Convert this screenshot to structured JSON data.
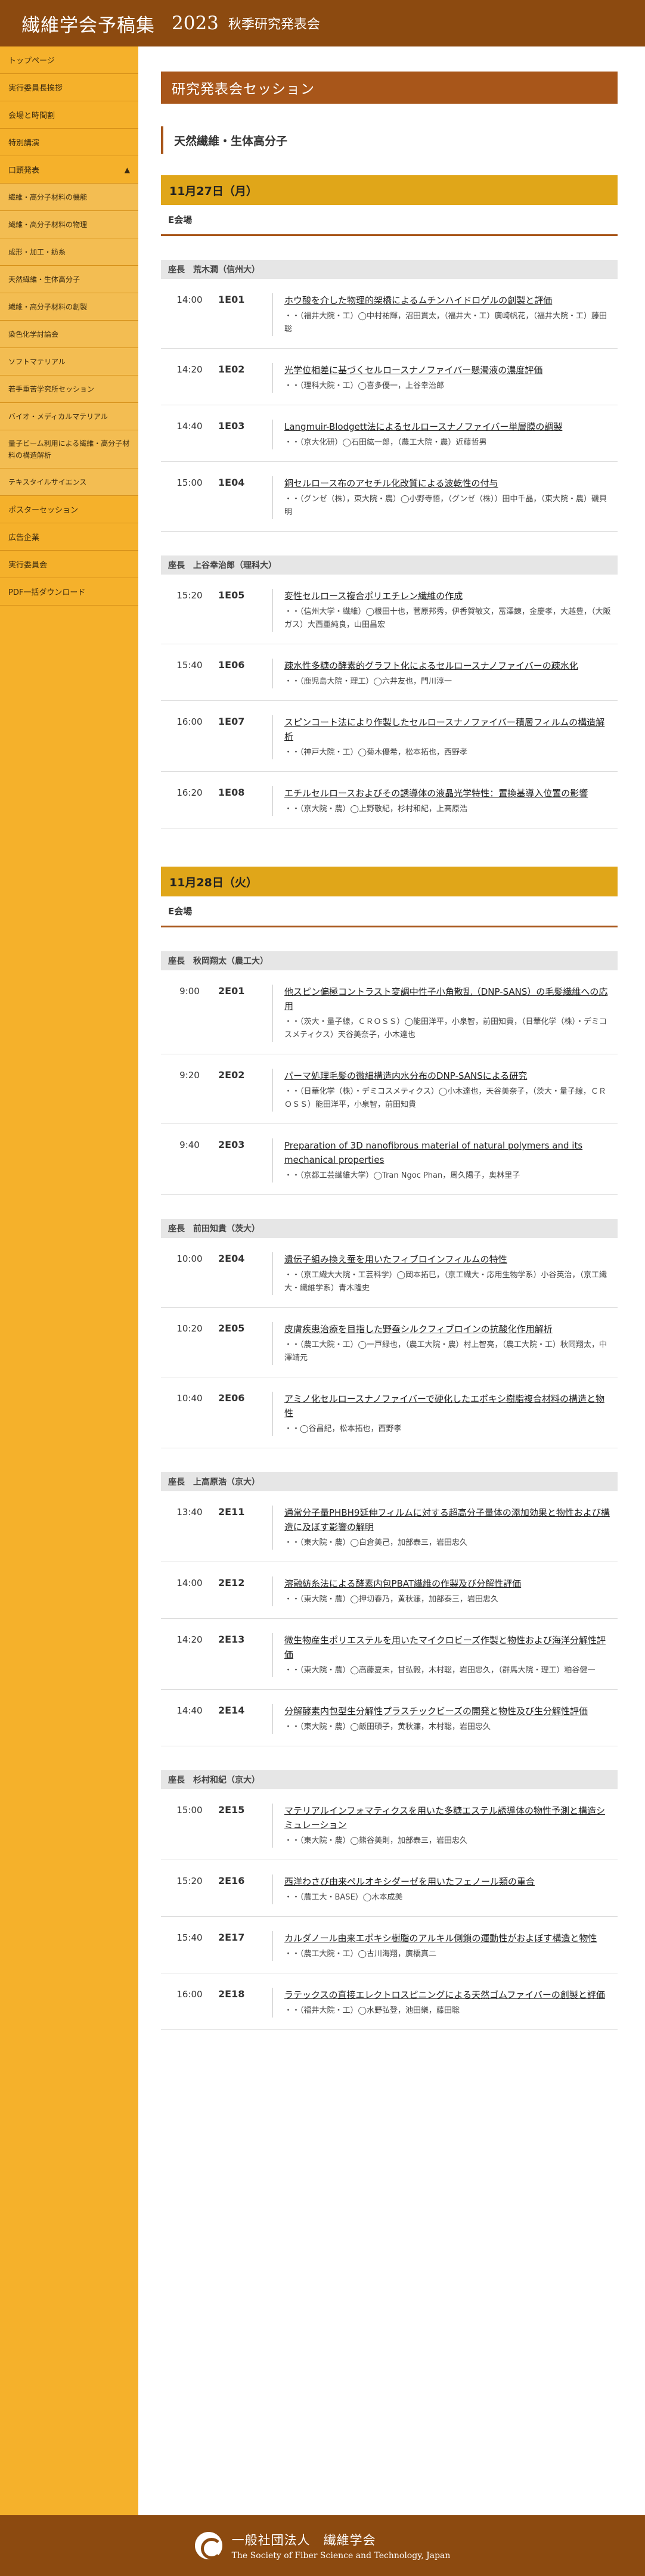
{
  "header": {
    "brand": "繊維学会予稿集",
    "year": "2023",
    "subtitle": "秋季研究発表会"
  },
  "sidebar": {
    "items": [
      {
        "label": "トップページ"
      },
      {
        "label": "実行委員長挨拶"
      },
      {
        "label": "会場と時間割"
      },
      {
        "label": "特別講演"
      },
      {
        "label": "口頭発表",
        "expanded": true
      },
      {
        "label": "繊維・高分子材料の機能",
        "sub": true
      },
      {
        "label": "繊維・高分子材料の物理",
        "sub": true
      },
      {
        "label": "成形・加工・紡糸",
        "sub": true
      },
      {
        "label": "天然繊維・生体高分子",
        "sub": true
      },
      {
        "label": "繊維・高分子材料の創製",
        "sub": true
      },
      {
        "label": "染色化学討論会",
        "sub": true
      },
      {
        "label": "ソフトマテリアル",
        "sub": true
      },
      {
        "label": "若手重苦学究所セッション",
        "sub": true
      },
      {
        "label": "バイオ・メディカルマテリアル",
        "sub": true
      },
      {
        "label": "量子ビーム利用による繊維・高分子材料の構造解析",
        "sub": true,
        "tall": true
      },
      {
        "label": "テキスタイルサイエンス",
        "sub": true
      },
      {
        "label": "ポスターセッション"
      },
      {
        "label": "広告企業"
      },
      {
        "label": "実行委員会"
      },
      {
        "label": "PDF一括ダウンロード"
      }
    ]
  },
  "page_title": "研究発表会セッション",
  "session_title": "天然繊維・生体高分子",
  "days": [
    {
      "date": "11月27日（月）",
      "room": "E会場",
      "blocks": [
        {
          "chair": "座長　荒木潤（信州大）",
          "talks": [
            {
              "time": "14:00",
              "code": "1E01",
              "title": "ホウ酸を介した物理的架橋によるムチンハイドロゲルの創製と評価",
              "authors": "・・（福井大院・工）◯中村祐輝，沼田貫太，（福井大・工）廣崎帆花，（福井大院・工）藤田聡"
            },
            {
              "time": "14:20",
              "code": "1E02",
              "title": "光学位相差に基づくセルロースナノファイバー懸濁液の濃度評価",
              "authors": "・・（理科大院・工）◯喜多優一，上谷幸治郎"
            },
            {
              "time": "14:40",
              "code": "1E03",
              "title": "Langmuir-Blodgett法によるセルロースナノファイバー単層膜の調製",
              "authors": "・・（京大化研）◯石田紘一郎，（農工大院・農）近藤哲男"
            },
            {
              "time": "15:00",
              "code": "1E04",
              "title": "銅セルロース布のアセチル化改質による波乾性の付与",
              "authors": "・・（グンゼ（株），東大院・農）◯小野寺悟，（グンゼ（株））田中千晶，（東大院・農）磯貝明"
            }
          ]
        },
        {
          "chair": "座長　上谷幸治郎（理科大）",
          "talks": [
            {
              "time": "15:20",
              "code": "1E05",
              "title": "変性セルロース複合ポリエチレン繊維の作成",
              "authors": "・・（信州大学・繊維）◯根田十也，菅原邦秀，伊香賀敏文，冨澤錬，金慶孝，大越豊，（大阪ガス）大西亜純良，山田昌宏"
            },
            {
              "time": "15:40",
              "code": "1E06",
              "title": "疎水性多糖の酵素的グラフト化によるセルロースナノファイバーの疎水化",
              "authors": "・・（鹿児島大院・理工）◯六井友也，門川淳一"
            },
            {
              "time": "16:00",
              "code": "1E07",
              "title": "スピンコート法により作製したセルロースナノファイバー積層フィルムの構造解析",
              "authors": "・・（神戸大院・工）◯菊木優希，松本拓也，西野孝"
            },
            {
              "time": "16:20",
              "code": "1E08",
              "title": "エチルセルロースおよびその誘導体の液晶光学特性：置換基導入位置の影響",
              "authors": "・・（京大院・農）◯上野敬紀，杉村和紀，上高原浩"
            }
          ]
        }
      ]
    },
    {
      "date": "11月28日（火）",
      "room": "E会場",
      "blocks": [
        {
          "chair": "座長　秋岡翔太（農工大）",
          "talks": [
            {
              "time": "9:00",
              "code": "2E01",
              "title": "他スピン偏極コントラスト変調中性子小角散乱（DNP-SANS）の毛髪繊維への応用",
              "authors": "・・（茨大・量子線，ＣＲＯＳＳ）◯能田洋平，小泉智，前田知貴，（日華化学（株）・デミコスメティクス）天谷美奈子，小木達也"
            },
            {
              "time": "9:20",
              "code": "2E02",
              "title": "パーマ処理毛髪の微細構造内水分布のDNP-SANSによる研究",
              "authors": "・・（日華化学（株）・デミコスメティクス）◯小木達也，天谷美奈子，（茨大・量子線，ＣＲＯＳＳ）能田洋平，小泉智，前田知貴"
            },
            {
              "time": "9:40",
              "code": "2E03",
              "title": "Preparation of 3D nanofibrous material of natural polymers and its mechanical properties",
              "authors": "・・（京都工芸繊維大学）◯Tran Ngoc Phan，周久陽子，奥林里子"
            }
          ]
        },
        {
          "chair": "座長　前田知貴（茨大）",
          "talks": [
            {
              "time": "10:00",
              "code": "2E04",
              "title": "遺伝子組み換え蚕を用いたフィブロインフィルムの特性",
              "authors": "・・（京工繊大大院・工芸科学）◯岡本拓巳，（京工繊大・応用生物学系）小谷英治，（京工繊大・繊維学系）青木隆史"
            },
            {
              "time": "10:20",
              "code": "2E05",
              "title": "皮膚疾患治療を目指した野蚕シルクフィブロインの抗酸化作用解析",
              "authors": "・・（農工大院・工）◯一戸緑也，（農工大院・農）村上智亮，（農工大院・工）秋岡翔太，中澤靖元"
            },
            {
              "time": "10:40",
              "code": "2E06",
              "title": "アミノ化セルロースナノファイバーで硬化したエポキシ樹脂複合材料の構造と物性",
              "authors": "・・◯谷昌紀，松本拓也，西野孝"
            }
          ]
        },
        {
          "chair": "座長　上高原浩（京大）",
          "talks": [
            {
              "time": "13:40",
              "code": "2E11",
              "title": "通常分子量PHBH9延伸フィルムに対する超高分子量体の添加効果と物性および構造に及ぼす影響の解明",
              "authors": "・・（東大院・農）◯白倉美己，加部泰三，岩田忠久"
            },
            {
              "time": "14:00",
              "code": "2E12",
              "title": "溶融紡糸法による酵素内包PBAT繊維の作製及び分解性評価",
              "authors": "・・（東大院・農）◯押切春乃，黄秋濂，加部泰三，岩田忠久"
            },
            {
              "time": "14:20",
              "code": "2E13",
              "title": "微生物産生ポリエステルを用いたマイクロビーズ作製と物性および海洋分解性評価",
              "authors": "・・（東大院・農）◯高藤夏未，甘弘毅，木村聡，岩田忠久，（群馬大院・理工）粕谷健一"
            },
            {
              "time": "14:40",
              "code": "2E14",
              "title": "分解酵素内包型生分解性プラスチックビーズの開発と物性及び生分解性評価",
              "authors": "・・（東大院・農）◯飯田碩子，黄秋濂，木村聡，岩田忠久"
            }
          ]
        },
        {
          "chair": "座長　杉村和紀（京大）",
          "talks": [
            {
              "time": "15:00",
              "code": "2E15",
              "title": "マテリアルインフォマティクスを用いた多糖エステル誘導体の物性予測と構造シミュレーション",
              "authors": "・・（東大院・農）◯熊谷美則，加部泰三，岩田忠久"
            },
            {
              "time": "15:20",
              "code": "2E16",
              "title": "西洋わさび由来ペルオキシダーゼを用いたフェノール類の重合",
              "authors": "・・（農工大・BASE）◯木本成美"
            },
            {
              "time": "15:40",
              "code": "2E17",
              "title": "カルダノール由来エポキシ樹脂のアルキル側鎖の運動性がおよぼす構造と物性",
              "authors": "・・（農工大院・工）◯古川海翔，廣橋真二"
            },
            {
              "time": "16:00",
              "code": "2E18",
              "title": "ラテックスの直接エレクトロスピニングによる天然ゴムファイバーの創製と評価",
              "authors": "・・（福井大院・工）◯水野弘登，池田樂，藤田聡"
            }
          ]
        }
      ]
    }
  ],
  "footer": {
    "org_jp": "一般社団法人　繊維学会",
    "org_en": "The Society of Fiber Science and Technology, Japan"
  }
}
